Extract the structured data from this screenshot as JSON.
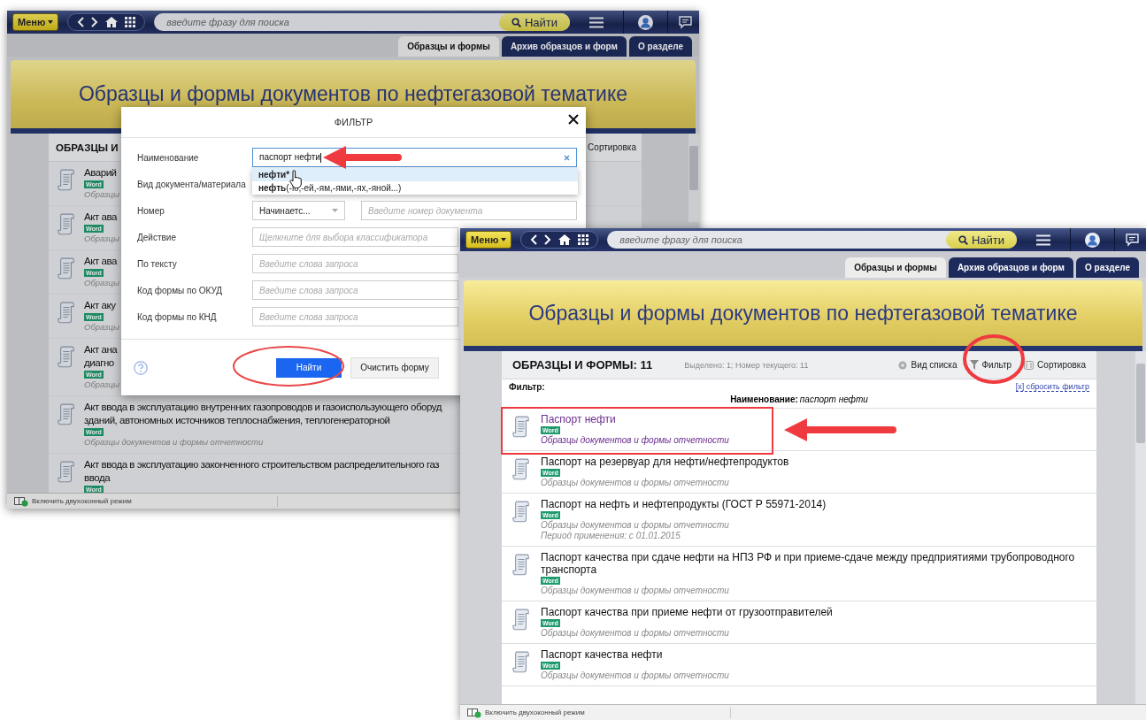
{
  "back_window": {
    "toolbar": {
      "menu_button": "Меню",
      "search_placeholder": "введите фразу для поиска",
      "search_button": "Найти"
    },
    "tabs": [
      {
        "label": "Образцы и формы",
        "selected": true
      },
      {
        "label": "Архив образцов и форм",
        "selected": false
      },
      {
        "label": "О разделе",
        "selected": false
      }
    ],
    "banner_title": "Образцы и формы документов по нефтегазовой тематике",
    "list_title": "ОБРАЗЦЫ И",
    "sort_label": "Сортировка",
    "items": [
      {
        "title_lines": [
          "Аварий"
        ],
        "badge": "Word",
        "category": "Образцы"
      },
      {
        "title_lines": [
          "Акт ава"
        ],
        "badge": "Word",
        "category": "Образцы"
      },
      {
        "title_lines": [
          "Акт ава"
        ],
        "badge": "Word",
        "category": "Образцы"
      },
      {
        "title_lines": [
          "Акт аку"
        ],
        "badge": "Word",
        "category": "Образцы"
      },
      {
        "title_lines": [
          "Акт ана",
          "диагно"
        ],
        "badge": "Word",
        "category": "Образцы"
      },
      {
        "title_lines": [
          "Акт ввода в эксплуатацию внутренних газопроводов и газоиспользующего оборуд",
          "зданий, автономных источников теплоснабжения, теплогенераторной"
        ],
        "badge": "Word",
        "category": "Образцы документов и формы отчетности"
      },
      {
        "title_lines": [
          "Акт ввода в эксплуатацию законченного строительством распределительного газ",
          "ввода"
        ],
        "badge": "Word"
      }
    ],
    "status_bar": "Включить двухоконный режим"
  },
  "filter_dialog": {
    "title": "ФИЛЬТР",
    "fields": [
      {
        "kind": "text",
        "label": "Наименование",
        "value": "паспорт нефти",
        "suggestions": [
          {
            "word": "нефти*",
            "selected": true
          },
          {
            "word": "нефть",
            "forms": "(-ю,-ей,-ям,-ями,-ях,-яной...)",
            "selected": false
          }
        ]
      },
      {
        "kind": "text",
        "label": "Вид документа/материала"
      },
      {
        "kind": "number",
        "label": "Номер",
        "select": "Начинаетс...",
        "placeholder": "Введите номер документа"
      },
      {
        "kind": "text",
        "label": "Действие",
        "placeholder": "Щелкните для выбора классификатора"
      },
      {
        "kind": "text",
        "label": "По тексту",
        "placeholder": "Введите слова запроса"
      },
      {
        "kind": "text",
        "label": "Код формы по ОКУД",
        "placeholder": "Введите слова запроса"
      },
      {
        "kind": "text",
        "label": "Код формы по КНД",
        "placeholder": "Введите слова запроса"
      }
    ],
    "find_button": "Найти",
    "clear_button": "Очистить форму"
  },
  "front_window": {
    "toolbar": {
      "menu_button": "Меню",
      "search_placeholder": "введите фразу для поиска",
      "search_button": "Найти"
    },
    "tabs": [
      {
        "label": "Образцы и формы",
        "selected": true
      },
      {
        "label": "Архив образцов и форм",
        "selected": false
      },
      {
        "label": "О разделе",
        "selected": false
      }
    ],
    "banner_title": "Образцы и формы документов по нефтегазовой тематике",
    "list_title": "ОБРАЗЦЫ И ФОРМЫ: 11",
    "selection_info": "Выделено: 1; Номер текущего: 11",
    "view_label": "Вид списка",
    "filter_label": "Фильтр",
    "sort_label": "Сортировка",
    "filter_heading": "Фильтр:",
    "reset_filter": "[x] сбросить фильтр",
    "filter_name": "Наименование:",
    "filter_value": "паспорт нефти",
    "items": [
      {
        "title": "Паспорт нефти",
        "badge": "Word",
        "category": "Образцы документов и формы отчетности",
        "selected": true
      },
      {
        "title": "Паспорт на резервуар для нефти/нефтепродуктов",
        "badge": "Word",
        "category": "Образцы документов и формы отчетности",
        "selected": false
      },
      {
        "title": "Паспорт на нефть и нефтепродукты (ГОСТ Р 55971-2014)",
        "badge": "Word",
        "category": "Образцы документов и формы отчетности",
        "period": "Период применения: с 01.01.2015",
        "selected": false
      },
      {
        "title": "Паспорт качества при сдаче нефти на НПЗ РФ и при приеме-сдаче между предприятиями трубопроводного транспорта",
        "badge": "Word",
        "category": "Образцы документов и формы отчетности",
        "selected": false
      },
      {
        "title": "Паспорт качества при приеме нефти от грузоотправителей",
        "badge": "Word",
        "category": "Образцы документов и формы отчетности",
        "selected": false
      },
      {
        "title": "Паспорт качества нефти",
        "badge": "Word",
        "category": "Образцы документов и формы отчетности",
        "selected": false
      }
    ],
    "status_bar": "Включить двухоконный режим"
  }
}
